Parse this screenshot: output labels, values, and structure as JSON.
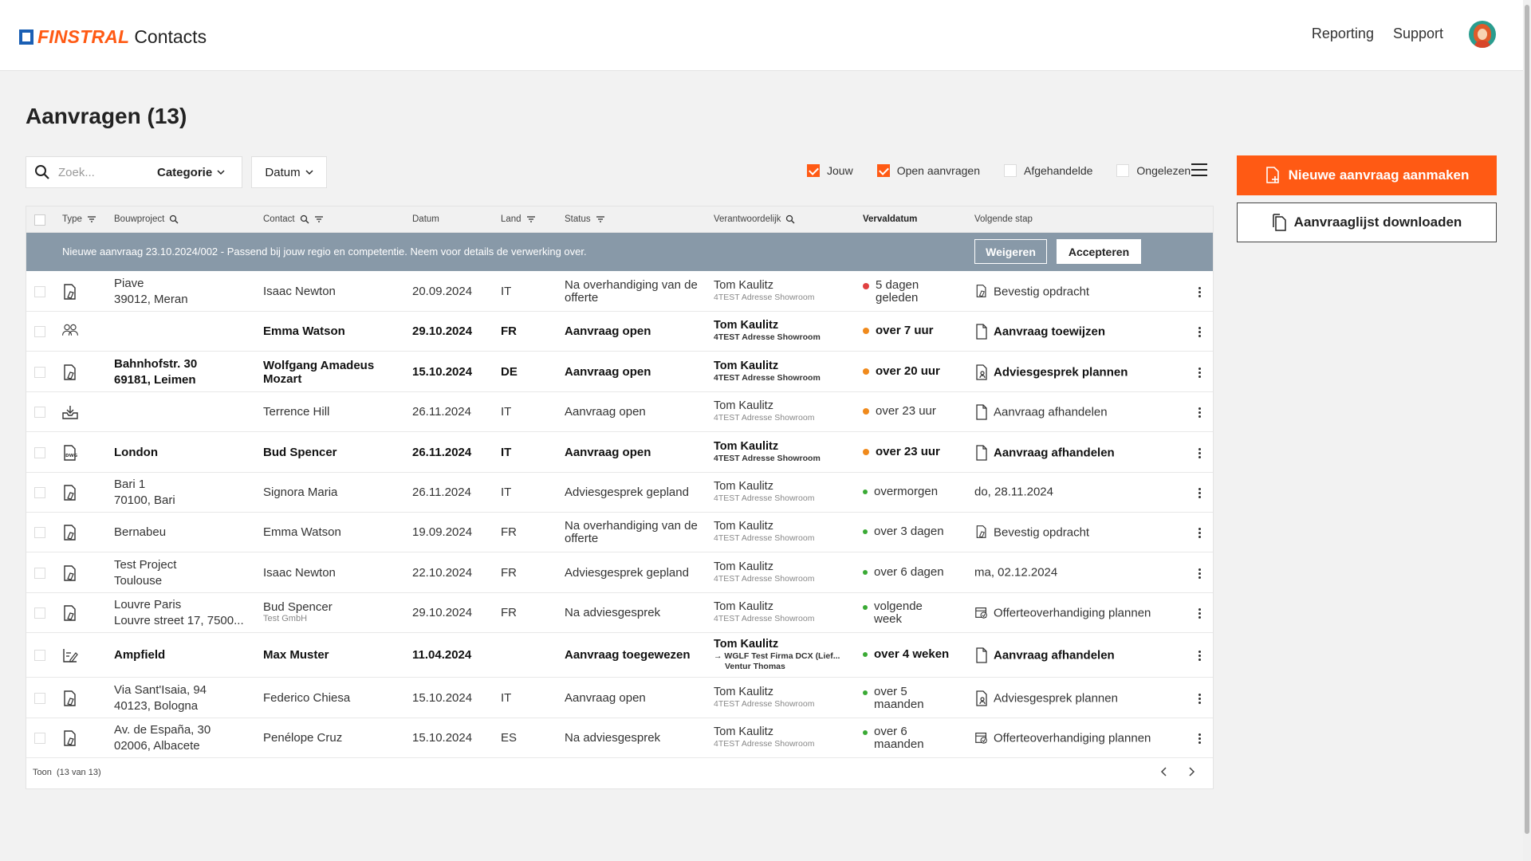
{
  "header": {
    "logo_word": "FINSTRAL",
    "app_name": "Contacts",
    "nav": [
      "Reporting",
      "Support"
    ]
  },
  "page": {
    "title": "Aanvragen (13)"
  },
  "filters": {
    "search_placeholder": "Zoek...",
    "category_label": "Categorie",
    "date_label": "Datum",
    "checkboxes": [
      {
        "label": "Jouw",
        "checked": true
      },
      {
        "label": "Open aanvragen",
        "checked": true
      },
      {
        "label": "Afgehandelde",
        "checked": false
      },
      {
        "label": "Ongelezen",
        "checked": false
      }
    ]
  },
  "actions": {
    "new_request": "Nieuwe aanvraag aanmaken",
    "download_list": "Aanvraaglijst downloaden"
  },
  "columns": [
    "Type",
    "Bouwproject",
    "Contact",
    "Datum",
    "Land",
    "Status",
    "Verantwoordelijk",
    "Vervaldatum",
    "Volgende stap"
  ],
  "banner": {
    "message": "Nieuwe aanvraag 23.10.2024/002 - Passend bij jouw regio en competentie. Neem voor details de verwerking over.",
    "reject": "Weigeren",
    "accept": "Accepteren"
  },
  "colors": {
    "accent": "#ff5a14",
    "banner": "#8899a8",
    "red": "#e04040",
    "orange": "#f08a1c",
    "green": "#3aaa35"
  },
  "rows": [
    {
      "bold": false,
      "icon": "document-sign-icon",
      "project": [
        "Piave",
        "39012, Meran"
      ],
      "contact": "Isaac Newton",
      "contact_sub": "",
      "date": "20.09.2024",
      "country": "IT",
      "status": "Na overhandiging van de offerte",
      "resp_name": "Tom Kaulitz",
      "resp_sub": "4TEST Adresse Showroom",
      "resp_sub2": "",
      "due": "5 dagen geleden",
      "due_color": "red",
      "next": "Bevestig opdracht",
      "next_icon": "document-sign-icon"
    },
    {
      "bold": true,
      "icon": "people-icon",
      "project": [],
      "contact": "Emma Watson",
      "contact_sub": "",
      "date": "29.10.2024",
      "country": "FR",
      "status": "Aanvraag open",
      "resp_name": "Tom Kaulitz",
      "resp_sub": "4TEST Adresse Showroom",
      "resp_sub2": "",
      "due": "over 7 uur",
      "due_color": "orange",
      "next": "Aanvraag toewijzen",
      "next_icon": "document-icon"
    },
    {
      "bold": true,
      "icon": "document-sign-icon",
      "project": [
        "Bahnhofstr. 30",
        "69181, Leimen"
      ],
      "contact": "Wolfgang Amadeus Mozart",
      "contact_sub": "",
      "date": "15.10.2024",
      "country": "DE",
      "status": "Aanvraag open",
      "resp_name": "Tom Kaulitz",
      "resp_sub": "4TEST Adresse Showroom",
      "resp_sub2": "",
      "due": "over 20 uur",
      "due_color": "orange",
      "next": "Adviesgesprek plannen",
      "next_icon": "document-person-icon"
    },
    {
      "bold": false,
      "icon": "inbox-icon",
      "project": [],
      "contact": "Terrence Hill",
      "contact_sub": "",
      "date": "26.11.2024",
      "country": "IT",
      "status": "Aanvraag open",
      "resp_name": "Tom Kaulitz",
      "resp_sub": "4TEST Adresse Showroom",
      "resp_sub2": "",
      "due": "over 23 uur",
      "due_color": "orange",
      "next": "Aanvraag afhandelen",
      "next_icon": "document-icon"
    },
    {
      "bold": true,
      "icon": "dwg-file-icon",
      "project": [
        "London"
      ],
      "contact": "Bud Spencer",
      "contact_sub": "",
      "date": "26.11.2024",
      "country": "IT",
      "status": "Aanvraag open",
      "resp_name": "Tom Kaulitz",
      "resp_sub": "4TEST Adresse Showroom",
      "resp_sub2": "",
      "due": "over 23 uur",
      "due_color": "orange",
      "next": "Aanvraag afhandelen",
      "next_icon": "document-icon"
    },
    {
      "bold": false,
      "icon": "document-sign-icon",
      "project": [
        "Bari 1",
        "70100, Bari"
      ],
      "contact": "Signora Maria",
      "contact_sub": "",
      "date": "26.11.2024",
      "country": "IT",
      "status": "Adviesgesprek gepland",
      "resp_name": "Tom Kaulitz",
      "resp_sub": "4TEST Adresse Showroom",
      "resp_sub2": "",
      "due": "overmorgen",
      "due_color": "green",
      "next": "do, 28.11.2024",
      "next_icon": ""
    },
    {
      "bold": false,
      "icon": "document-sign-icon",
      "project": [
        "Bernabeu"
      ],
      "contact": "Emma Watson",
      "contact_sub": "",
      "date": "19.09.2024",
      "country": "FR",
      "status": "Na overhandiging van de offerte",
      "resp_name": "Tom Kaulitz",
      "resp_sub": "4TEST Adresse Showroom",
      "resp_sub2": "",
      "due": "over 3 dagen",
      "due_color": "green",
      "next": "Bevestig opdracht",
      "next_icon": "document-sign-icon"
    },
    {
      "bold": false,
      "icon": "document-sign-icon",
      "project": [
        "Test Project",
        "Toulouse"
      ],
      "contact": "Isaac Newton",
      "contact_sub": "",
      "date": "22.10.2024",
      "country": "FR",
      "status": "Adviesgesprek gepland",
      "resp_name": "Tom Kaulitz",
      "resp_sub": "4TEST Adresse Showroom",
      "resp_sub2": "",
      "due": "over 6 dagen",
      "due_color": "green",
      "next": "ma, 02.12.2024",
      "next_icon": ""
    },
    {
      "bold": false,
      "icon": "document-sign-icon",
      "project": [
        "Louvre Paris",
        "Louvre street 17, 7500..."
      ],
      "contact": "Bud Spencer",
      "contact_sub": "Test GmbH",
      "date": "29.10.2024",
      "country": "FR",
      "status": "Na adviesgesprek",
      "resp_name": "Tom Kaulitz",
      "resp_sub": "4TEST Adresse Showroom",
      "resp_sub2": "",
      "due": "volgende week",
      "due_color": "green",
      "next": "Offerteoverhandiging plannen",
      "next_icon": "calendar-sync-icon"
    },
    {
      "bold": true,
      "icon": "edit-list-icon",
      "project": [
        "Ampfield"
      ],
      "contact": "Max Muster",
      "contact_sub": "",
      "date": "11.04.2024",
      "country": "",
      "status": "Aanvraag toegewezen",
      "resp_name": "Tom Kaulitz",
      "resp_sub": "→ WGLF Test Firma DCX (Lief...",
      "resp_sub2": "Ventur Thomas",
      "due": "over 4 weken",
      "due_color": "green",
      "next": "Aanvraag afhandelen",
      "next_icon": "document-icon"
    },
    {
      "bold": false,
      "icon": "document-sign-icon",
      "project": [
        "Via Sant'Isaia, 94",
        "40123, Bologna"
      ],
      "contact": "Federico Chiesa",
      "contact_sub": "",
      "date": "15.10.2024",
      "country": "IT",
      "status": "Aanvraag open",
      "resp_name": "Tom Kaulitz",
      "resp_sub": "4TEST Adresse Showroom",
      "resp_sub2": "",
      "due": "over 5 maanden",
      "due_color": "green",
      "next": "Adviesgesprek plannen",
      "next_icon": "document-person-icon"
    },
    {
      "bold": false,
      "icon": "document-sign-icon",
      "project": [
        "Av. de España, 30",
        "02006, Albacete"
      ],
      "contact": "Penélope Cruz",
      "contact_sub": "",
      "date": "15.10.2024",
      "country": "ES",
      "status": "Na adviesgesprek",
      "resp_name": "Tom Kaulitz",
      "resp_sub": "4TEST Adresse Showroom",
      "resp_sub2": "",
      "due": "over 6 maanden",
      "due_color": "green",
      "next": "Offerteoverhandiging plannen",
      "next_icon": "calendar-sync-icon"
    }
  ],
  "footer": {
    "show_label": "Toon",
    "count": "(13 van 13)"
  }
}
